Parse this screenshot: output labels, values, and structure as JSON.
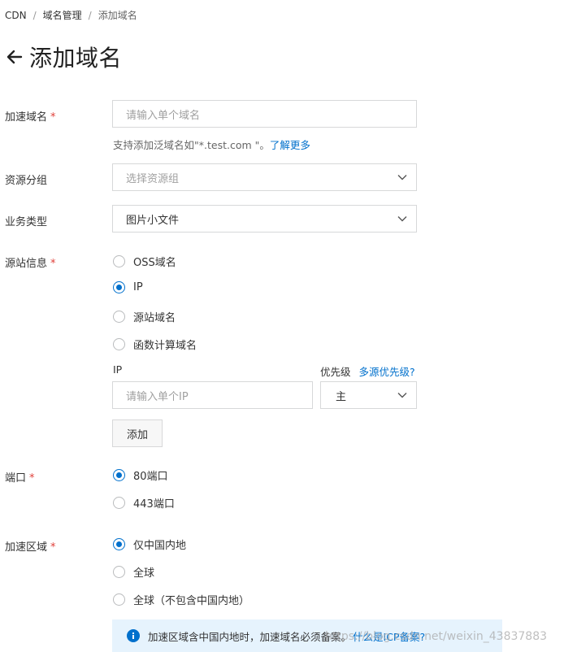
{
  "breadcrumb": {
    "items": [
      "CDN",
      "域名管理",
      "添加域名"
    ],
    "separator": "/"
  },
  "page_title": "添加域名",
  "form": {
    "domain": {
      "label": "加速域名",
      "required_mark": "*",
      "placeholder": "请输入单个域名",
      "hint_text": "支持添加泛域名如\"*.test.com \"。",
      "hint_link": "了解更多"
    },
    "resource_group": {
      "label": "资源分组",
      "placeholder": "选择资源组"
    },
    "business_type": {
      "label": "业务类型",
      "value": "图片小文件"
    },
    "origin": {
      "label": "源站信息",
      "required_mark": "*",
      "options": [
        {
          "label": "OSS域名",
          "checked": false
        },
        {
          "label": "IP",
          "checked": true
        },
        {
          "label": "源站域名",
          "checked": false
        },
        {
          "label": "函数计算域名",
          "checked": false
        }
      ],
      "ip_label": "IP",
      "ip_placeholder": "请输入单个IP",
      "priority_label": "优先级",
      "priority_link": "多源优先级?",
      "priority_value": "主",
      "add_button": "添加"
    },
    "port": {
      "label": "端口",
      "required_mark": "*",
      "options": [
        {
          "label": "80端口",
          "checked": true
        },
        {
          "label": "443端口",
          "checked": false
        }
      ]
    },
    "region": {
      "label": "加速区域",
      "required_mark": "*",
      "options": [
        {
          "label": "仅中国内地",
          "checked": true
        },
        {
          "label": "全球",
          "checked": false
        },
        {
          "label": "全球（不包含中国内地）",
          "checked": false
        }
      ]
    }
  },
  "notice": {
    "text": "加速区域含中国内地时，加速域名必须备案。",
    "link": "什么是ICP备案?"
  },
  "watermark": "https://blog.csdn.net/weixin_43837883",
  "colors": {
    "accent": "#0070cc",
    "required": "#e0403a",
    "notice_bg": "#e6f3fd"
  }
}
